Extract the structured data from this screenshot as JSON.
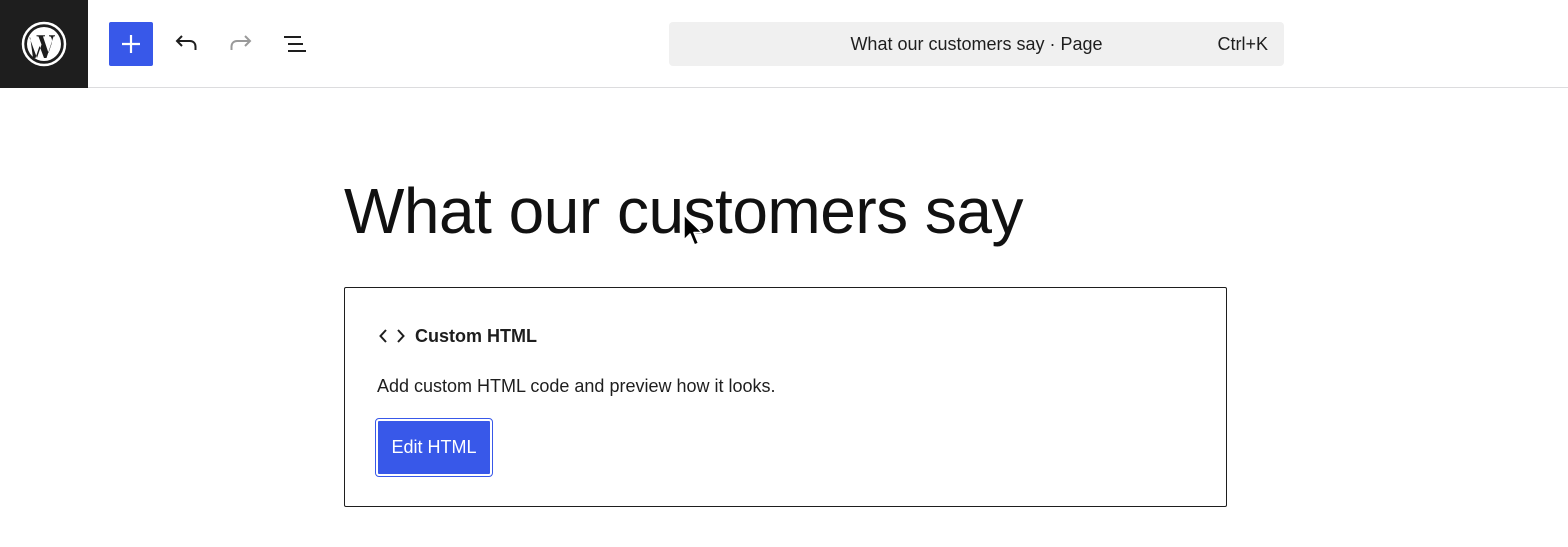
{
  "toolbar": {
    "logo_icon": "wordpress-logo-icon",
    "inserter_icon": "plus-icon",
    "undo_icon": "undo-icon",
    "redo_icon": "redo-icon",
    "list_view_icon": "list-view-icon",
    "accent_color": "#3858e9"
  },
  "command_bar": {
    "title": "What our customers say · Page",
    "shortcut": "Ctrl+K"
  },
  "page": {
    "title": "What our customers say"
  },
  "html_block": {
    "icon": "code-brackets-icon",
    "label": "Custom HTML",
    "description": "Add custom HTML code and preview how it looks.",
    "button_label": "Edit HTML"
  }
}
